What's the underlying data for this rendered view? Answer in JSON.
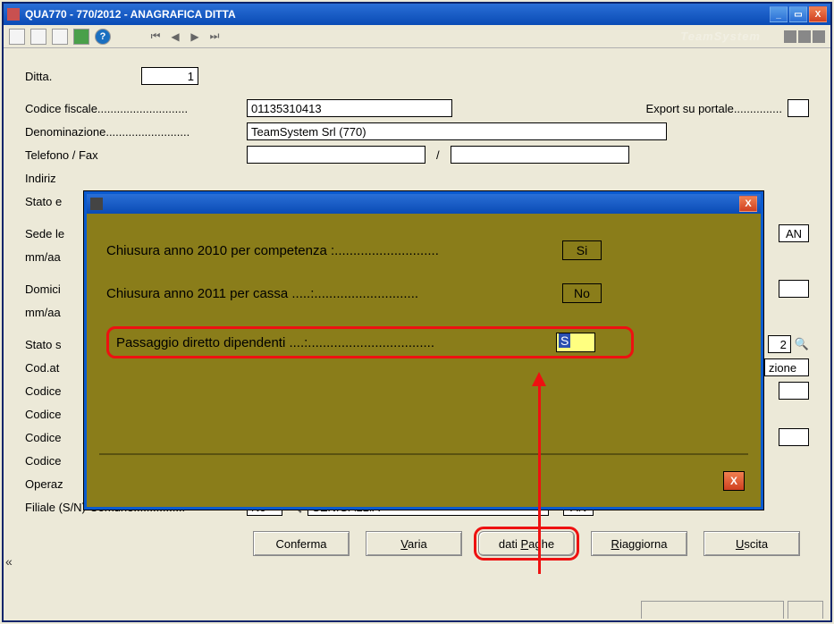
{
  "window": {
    "title": "QUA770  - 770/2012  -  ANAGRAFICA DITTA",
    "brand": "TeamSystem"
  },
  "toolbar": {
    "help_glyph": "?"
  },
  "form": {
    "ditta_label": "Ditta.",
    "ditta_value": "1",
    "codice_fiscale_label": "Codice fiscale............................",
    "codice_fiscale_value": "01135310413",
    "export_label": "Export su portale...............",
    "denominazione_label": "Denominazione..........................",
    "denominazione_value": "TeamSystem Srl (770)",
    "telefono_label": "Telefono / Fax",
    "indirizzo_label": "Indiriz",
    "stato_label": "Stato e",
    "sede_label": "Sede le",
    "mm1_label": "mm/aa",
    "domicilio_label": "Domici",
    "mm2_label": "mm/aa",
    "stato_s_label": "Stato s",
    "cod_at_label": "Cod.at",
    "codice1": "Codice",
    "codice2": "Codice",
    "codice3": "Codice",
    "codice4": "Codice",
    "operaz_label": "Operaz",
    "filiale_label": "Filiale (S/N)-Comune................",
    "filiale_val": "No",
    "filiale_comune": "SENIGALLIA",
    "prov": "AN",
    "prov2": "AN",
    "partial_right": "zione",
    "dot_two": "2"
  },
  "buttons": {
    "conferma": "Conferma",
    "varia": "Varia",
    "varia_ul": "V",
    "dati_paghe": "dati Paghe",
    "dati_paghe_ul": "P",
    "riaggiorna": "Riaggiorna",
    "riaggiorna_ul": "R",
    "uscita": "Uscita",
    "uscita_ul": "U"
  },
  "popup": {
    "row1_label": "Chiusura anno 2010 per competenza :............................",
    "row1_val": "Si",
    "row2_label": "Chiusura anno 2011 per cassa  .....:............................",
    "row2_val": "No",
    "row3_label": "Passaggio diretto dipendenti  ....:..................................",
    "row3_val": "S"
  }
}
